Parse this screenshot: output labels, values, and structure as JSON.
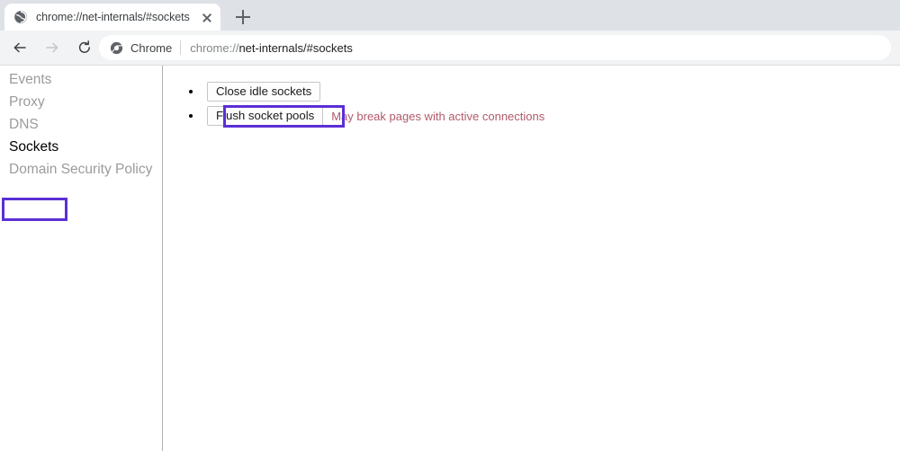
{
  "window": {
    "tab": {
      "favicon": "net-internals-globe-icon",
      "title": "chrome://net-internals/#sockets",
      "close_label": "close-tab"
    },
    "new_tab_label": "New tab"
  },
  "toolbar": {
    "back_label": "Back",
    "forward_label": "Forward",
    "reload_label": "Reload",
    "omnibox": {
      "icon": "chrome-circle-icon",
      "chip_label": "Chrome",
      "url_scheme": "chrome://",
      "url_rest": "net-internals/#sockets"
    }
  },
  "sidebar": {
    "items": [
      {
        "label": "Events",
        "selected": false
      },
      {
        "label": "Proxy",
        "selected": false
      },
      {
        "label": "DNS",
        "selected": false
      },
      {
        "label": "Sockets",
        "selected": true
      },
      {
        "label": "Domain Security Policy",
        "selected": false
      }
    ]
  },
  "main": {
    "actions": [
      {
        "button_label": "Close idle sockets",
        "hint": "",
        "annotated": false
      },
      {
        "button_label": "Flush socket pools",
        "hint": "May break pages with active connections",
        "annotated": true
      }
    ]
  },
  "annotations": {
    "color": "#5b2fd6",
    "targets": [
      "Sockets",
      "Flush socket pools"
    ]
  },
  "colors": {
    "tabstrip_bg": "#dee1e6",
    "toolbar_bg": "#f1f3f4",
    "page_bg": "#ffffff",
    "nav_inactive": "#9b9b9b",
    "nav_active": "#000000",
    "hint_red": "#b05a6a",
    "annotation_purple": "#5b2fd6"
  }
}
